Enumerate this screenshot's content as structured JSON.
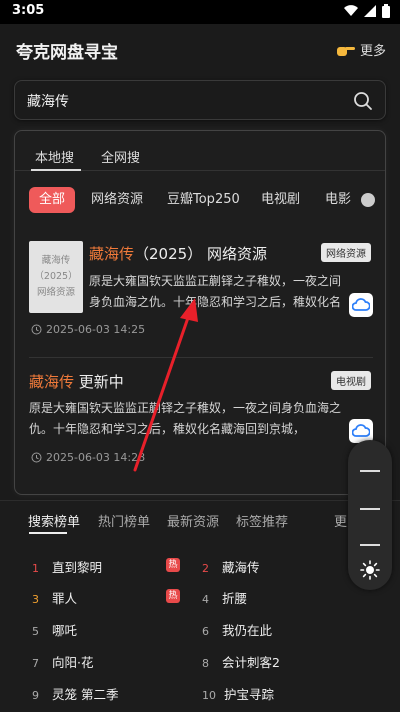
{
  "status": {
    "time": "3:05"
  },
  "app": {
    "title": "夸克网盘寻宝",
    "more_label": "更多"
  },
  "search": {
    "value": "藏海传"
  },
  "tabs": [
    {
      "label": "本地搜"
    },
    {
      "label": "全网搜"
    }
  ],
  "chips": [
    {
      "label": "全部"
    },
    {
      "label": "网络资源"
    },
    {
      "label": "豆瓣Top250"
    },
    {
      "label": "电视剧"
    },
    {
      "label": "电影"
    }
  ],
  "results": [
    {
      "thumb_lines": [
        "藏海传",
        "（2025）",
        "网络资源"
      ],
      "title_highlight": "藏海传",
      "title_rest": "（2025） 网络资源",
      "badge": "网络资源",
      "desc": "原是大雍国钦天监监正蒯铎之子稚奴，一夜之间身负血海之仇。十年隐忍和学习之后，稚奴化名藏海回到京城，",
      "date": "2025-06-03 14:25"
    },
    {
      "title_highlight": "藏海传",
      "title_rest": " 更新中",
      "badge": "电视剧",
      "desc": "原是大雍国钦天监监正蒯铎之子稚奴，一夜之间身负血海之仇。十年隐忍和学习之后，稚奴化名藏海回到京城，",
      "date": "2025-06-03 14:28"
    }
  ],
  "bottom_tabs": [
    {
      "label": "搜索榜单"
    },
    {
      "label": "热门榜单"
    },
    {
      "label": "最新资源"
    },
    {
      "label": "标签推荐"
    },
    {
      "label": "更多"
    }
  ],
  "rankings": [
    {
      "num": "1",
      "name": "直到黎明",
      "hot": true
    },
    {
      "num": "2",
      "name": "藏海传",
      "hot": false
    },
    {
      "num": "3",
      "name": "罪人",
      "hot": true
    },
    {
      "num": "4",
      "name": "折腰",
      "hot": false
    },
    {
      "num": "5",
      "name": "哪吒",
      "hot": false
    },
    {
      "num": "6",
      "name": "我仍在此",
      "hot": false
    },
    {
      "num": "7",
      "name": "向阳·花",
      "hot": false
    },
    {
      "num": "8",
      "name": "会计刺客2",
      "hot": false
    },
    {
      "num": "9",
      "name": "灵笼 第二季",
      "hot": false
    },
    {
      "num": "10",
      "name": "护宝寻踪",
      "hot": false
    }
  ],
  "hot_label": "热",
  "colors": {
    "accent": "#ef5a5a",
    "highlight": "#f07a3a",
    "arrow": "#e8202a"
  }
}
